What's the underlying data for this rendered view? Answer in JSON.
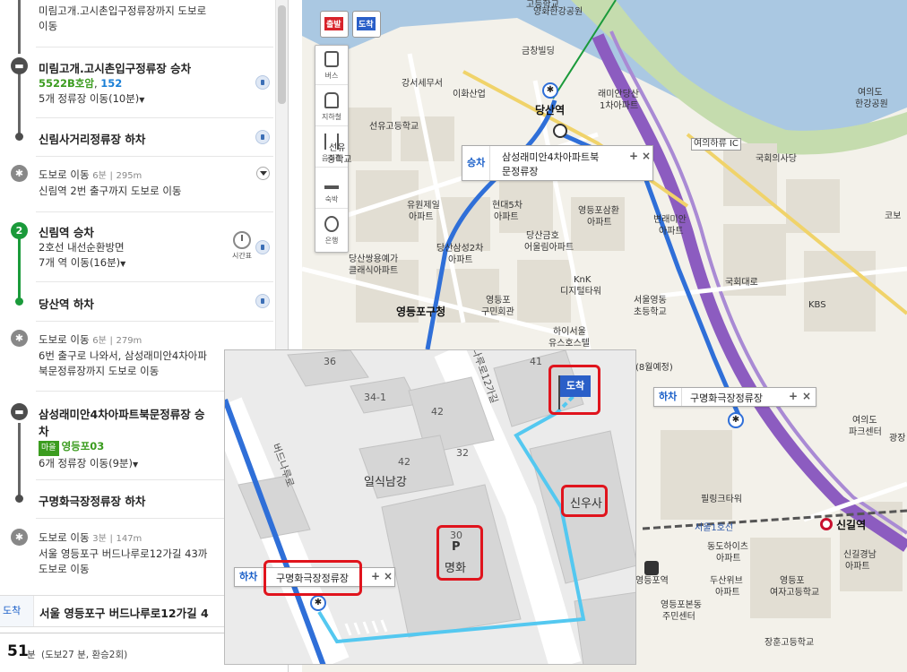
{
  "panel": {
    "steps": [
      {
        "id": "s0",
        "line1": "미림고개.고시촌입구정류장까지 도보로",
        "line2": "이동"
      },
      {
        "id": "s1",
        "title": "미림고개.고시촌입구정류장 승차",
        "bus_a": "5522B호암",
        "bus_b": "152",
        "stops": "5개 정류장 이동(10분)"
      },
      {
        "id": "s2",
        "title": "신림사거리정류장 하차"
      },
      {
        "id": "s3",
        "title": "도보로 이동",
        "meta_min": "6분",
        "meta_m": "295m",
        "line2": "신림역 2번 출구까지 도보로 이동"
      },
      {
        "id": "s4",
        "node": "2",
        "title": "신림역 승차",
        "line1": "2호선 내선순환방면",
        "stops": "7개 역 이동(16분)",
        "timetable": "시간표"
      },
      {
        "id": "s5",
        "title": "당산역 하차"
      },
      {
        "id": "s6",
        "title": "도보로 이동",
        "meta_min": "6분",
        "meta_m": "279m",
        "line2": "6번 출구로 나와서, 삼성래미안4차아파",
        "line3": "북문정류장까지 도보로 이동"
      },
      {
        "id": "s7",
        "title": "삼성래미안4차아파트북문정류장 승",
        "title2": "차",
        "tag": "마을",
        "bus": "영등포03",
        "stops": "6개 정류장 이동(9분)"
      },
      {
        "id": "s8",
        "title": "구명화극장정류장 하차"
      },
      {
        "id": "s9",
        "title": "도보로 이동",
        "meta_min": "3분",
        "meta_m": "147m",
        "line2": "서울 영등포구 버드나루로12가길 43까",
        "line3": "도보로 이동"
      }
    ],
    "arrive_tag": "도착",
    "arrive_text": "서울 영등포구 버드나루로12가길 4",
    "total_num": "51",
    "total_unit": "분",
    "total_rest": "(도보27 분, 환승2회)"
  },
  "map": {
    "start_btn": "출발",
    "end_btn": "도착",
    "tools": [
      "버스",
      "지하철",
      "음식점",
      "숙박",
      "은행"
    ],
    "labels": [
      "고등학교",
      "양화한강공원",
      "금창빌딩",
      "강서세무서",
      "이화산업",
      "래미안당산",
      "1차아파트",
      "당산역",
      "여의도",
      "한강공원",
      "선유고등학교",
      "여의하류 IC",
      "국회의사당",
      "유원제일",
      "아파트",
      "현대5차",
      "아파트",
      "영등포삼환",
      "아파트",
      "당산금호",
      "어울림아파트",
      "당산삼성2차",
      "아파트",
      "변래미안",
      "아파트",
      "당산쌍용예가",
      "클래식아파트",
      "KnK",
      "디지털타워",
      "영등포",
      "구민회관",
      "서울영동",
      "초등학교",
      "영등포구청",
      "KBS",
      "하이서울",
      "유스호스텔",
      "(8월예정)",
      "여의도",
      "파크센터",
      "필링크타워",
      "신길역",
      "동도하이츠",
      "아파트",
      "영등포역",
      "영등포본동",
      "주민센터",
      "두산위브",
      "아파트",
      "영등포",
      "여자고등학교",
      "신길경남",
      "아파트",
      "장훈고등학교",
      "광장",
      "코보",
      "선유",
      "중학교",
      "서울1호선",
      "국회대로"
    ],
    "callout_board": {
      "kind": "승차",
      "name1": "삼성래미안4차아파트북",
      "name2": "문정류장"
    },
    "callout_alight": {
      "kind": "하차",
      "name": "구명화극장정류장"
    }
  },
  "inset": {
    "labels": [
      "36",
      "34-1",
      "42",
      "42",
      "32",
      "일식남강",
      "30",
      "명화",
      "신우사",
      "41",
      "버드나루로",
      "나루로12가길"
    ],
    "callout": {
      "kind": "하차",
      "name": "구명화극장정류장"
    },
    "dest_flag": "도착",
    "parking": "P"
  },
  "colors": {
    "route_blue": "#2f6fd8",
    "walk_cyan": "#54c8f0",
    "subway_green": "#1a9a3a",
    "highlight_red": "#e0141d",
    "expressway": "#8c5cc0"
  }
}
